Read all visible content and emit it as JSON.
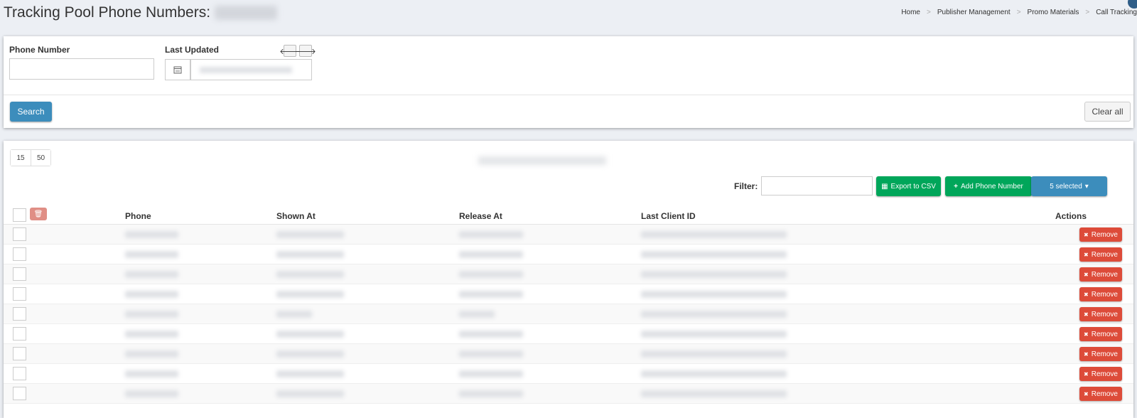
{
  "header": {
    "title": "Tracking Pool Phone Numbers:",
    "breadcrumb": [
      "Home",
      "Publisher Management",
      "Promo Materials",
      "Call Tracking"
    ]
  },
  "filters": {
    "phone_label": "Phone Number",
    "phone_value": "",
    "last_updated_label": "Last Updated",
    "search_label": "Search",
    "clear_label": "Clear all",
    "prev_icon": "arrow-left-icon",
    "next_icon": "arrow-right-icon"
  },
  "table": {
    "page_sizes": [
      "15",
      "50"
    ],
    "filter_label": "Filter:",
    "filter_value": "",
    "export_label": "Export to CSV",
    "add_label": "Add Phone Number",
    "selected_label": "5 selected",
    "columns": [
      "Phone",
      "Shown At",
      "Release At",
      "Last Client ID",
      "Actions"
    ],
    "remove_label": "Remove",
    "row_count": 9
  },
  "colors": {
    "primary": "#3c8dbc",
    "success": "#00a65a",
    "danger": "#dd4b39"
  }
}
